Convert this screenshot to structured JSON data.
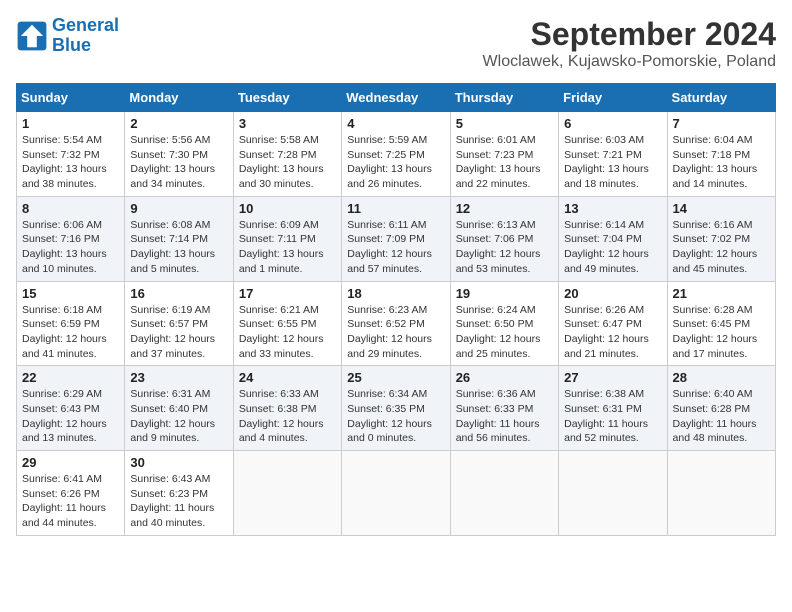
{
  "header": {
    "logo_line1": "General",
    "logo_line2": "Blue",
    "month_title": "September 2024",
    "location": "Wloclawek, Kujawsko-Pomorskie, Poland"
  },
  "days_of_week": [
    "Sunday",
    "Monday",
    "Tuesday",
    "Wednesday",
    "Thursday",
    "Friday",
    "Saturday"
  ],
  "weeks": [
    [
      {
        "day": "1",
        "info": "Sunrise: 5:54 AM\nSunset: 7:32 PM\nDaylight: 13 hours\nand 38 minutes."
      },
      {
        "day": "2",
        "info": "Sunrise: 5:56 AM\nSunset: 7:30 PM\nDaylight: 13 hours\nand 34 minutes."
      },
      {
        "day": "3",
        "info": "Sunrise: 5:58 AM\nSunset: 7:28 PM\nDaylight: 13 hours\nand 30 minutes."
      },
      {
        "day": "4",
        "info": "Sunrise: 5:59 AM\nSunset: 7:25 PM\nDaylight: 13 hours\nand 26 minutes."
      },
      {
        "day": "5",
        "info": "Sunrise: 6:01 AM\nSunset: 7:23 PM\nDaylight: 13 hours\nand 22 minutes."
      },
      {
        "day": "6",
        "info": "Sunrise: 6:03 AM\nSunset: 7:21 PM\nDaylight: 13 hours\nand 18 minutes."
      },
      {
        "day": "7",
        "info": "Sunrise: 6:04 AM\nSunset: 7:18 PM\nDaylight: 13 hours\nand 14 minutes."
      }
    ],
    [
      {
        "day": "8",
        "info": "Sunrise: 6:06 AM\nSunset: 7:16 PM\nDaylight: 13 hours\nand 10 minutes."
      },
      {
        "day": "9",
        "info": "Sunrise: 6:08 AM\nSunset: 7:14 PM\nDaylight: 13 hours\nand 5 minutes."
      },
      {
        "day": "10",
        "info": "Sunrise: 6:09 AM\nSunset: 7:11 PM\nDaylight: 13 hours\nand 1 minute."
      },
      {
        "day": "11",
        "info": "Sunrise: 6:11 AM\nSunset: 7:09 PM\nDaylight: 12 hours\nand 57 minutes."
      },
      {
        "day": "12",
        "info": "Sunrise: 6:13 AM\nSunset: 7:06 PM\nDaylight: 12 hours\nand 53 minutes."
      },
      {
        "day": "13",
        "info": "Sunrise: 6:14 AM\nSunset: 7:04 PM\nDaylight: 12 hours\nand 49 minutes."
      },
      {
        "day": "14",
        "info": "Sunrise: 6:16 AM\nSunset: 7:02 PM\nDaylight: 12 hours\nand 45 minutes."
      }
    ],
    [
      {
        "day": "15",
        "info": "Sunrise: 6:18 AM\nSunset: 6:59 PM\nDaylight: 12 hours\nand 41 minutes."
      },
      {
        "day": "16",
        "info": "Sunrise: 6:19 AM\nSunset: 6:57 PM\nDaylight: 12 hours\nand 37 minutes."
      },
      {
        "day": "17",
        "info": "Sunrise: 6:21 AM\nSunset: 6:55 PM\nDaylight: 12 hours\nand 33 minutes."
      },
      {
        "day": "18",
        "info": "Sunrise: 6:23 AM\nSunset: 6:52 PM\nDaylight: 12 hours\nand 29 minutes."
      },
      {
        "day": "19",
        "info": "Sunrise: 6:24 AM\nSunset: 6:50 PM\nDaylight: 12 hours\nand 25 minutes."
      },
      {
        "day": "20",
        "info": "Sunrise: 6:26 AM\nSunset: 6:47 PM\nDaylight: 12 hours\nand 21 minutes."
      },
      {
        "day": "21",
        "info": "Sunrise: 6:28 AM\nSunset: 6:45 PM\nDaylight: 12 hours\nand 17 minutes."
      }
    ],
    [
      {
        "day": "22",
        "info": "Sunrise: 6:29 AM\nSunset: 6:43 PM\nDaylight: 12 hours\nand 13 minutes."
      },
      {
        "day": "23",
        "info": "Sunrise: 6:31 AM\nSunset: 6:40 PM\nDaylight: 12 hours\nand 9 minutes."
      },
      {
        "day": "24",
        "info": "Sunrise: 6:33 AM\nSunset: 6:38 PM\nDaylight: 12 hours\nand 4 minutes."
      },
      {
        "day": "25",
        "info": "Sunrise: 6:34 AM\nSunset: 6:35 PM\nDaylight: 12 hours\nand 0 minutes."
      },
      {
        "day": "26",
        "info": "Sunrise: 6:36 AM\nSunset: 6:33 PM\nDaylight: 11 hours\nand 56 minutes."
      },
      {
        "day": "27",
        "info": "Sunrise: 6:38 AM\nSunset: 6:31 PM\nDaylight: 11 hours\nand 52 minutes."
      },
      {
        "day": "28",
        "info": "Sunrise: 6:40 AM\nSunset: 6:28 PM\nDaylight: 11 hours\nand 48 minutes."
      }
    ],
    [
      {
        "day": "29",
        "info": "Sunrise: 6:41 AM\nSunset: 6:26 PM\nDaylight: 11 hours\nand 44 minutes."
      },
      {
        "day": "30",
        "info": "Sunrise: 6:43 AM\nSunset: 6:23 PM\nDaylight: 11 hours\nand 40 minutes."
      },
      {
        "day": "",
        "info": ""
      },
      {
        "day": "",
        "info": ""
      },
      {
        "day": "",
        "info": ""
      },
      {
        "day": "",
        "info": ""
      },
      {
        "day": "",
        "info": ""
      }
    ]
  ]
}
